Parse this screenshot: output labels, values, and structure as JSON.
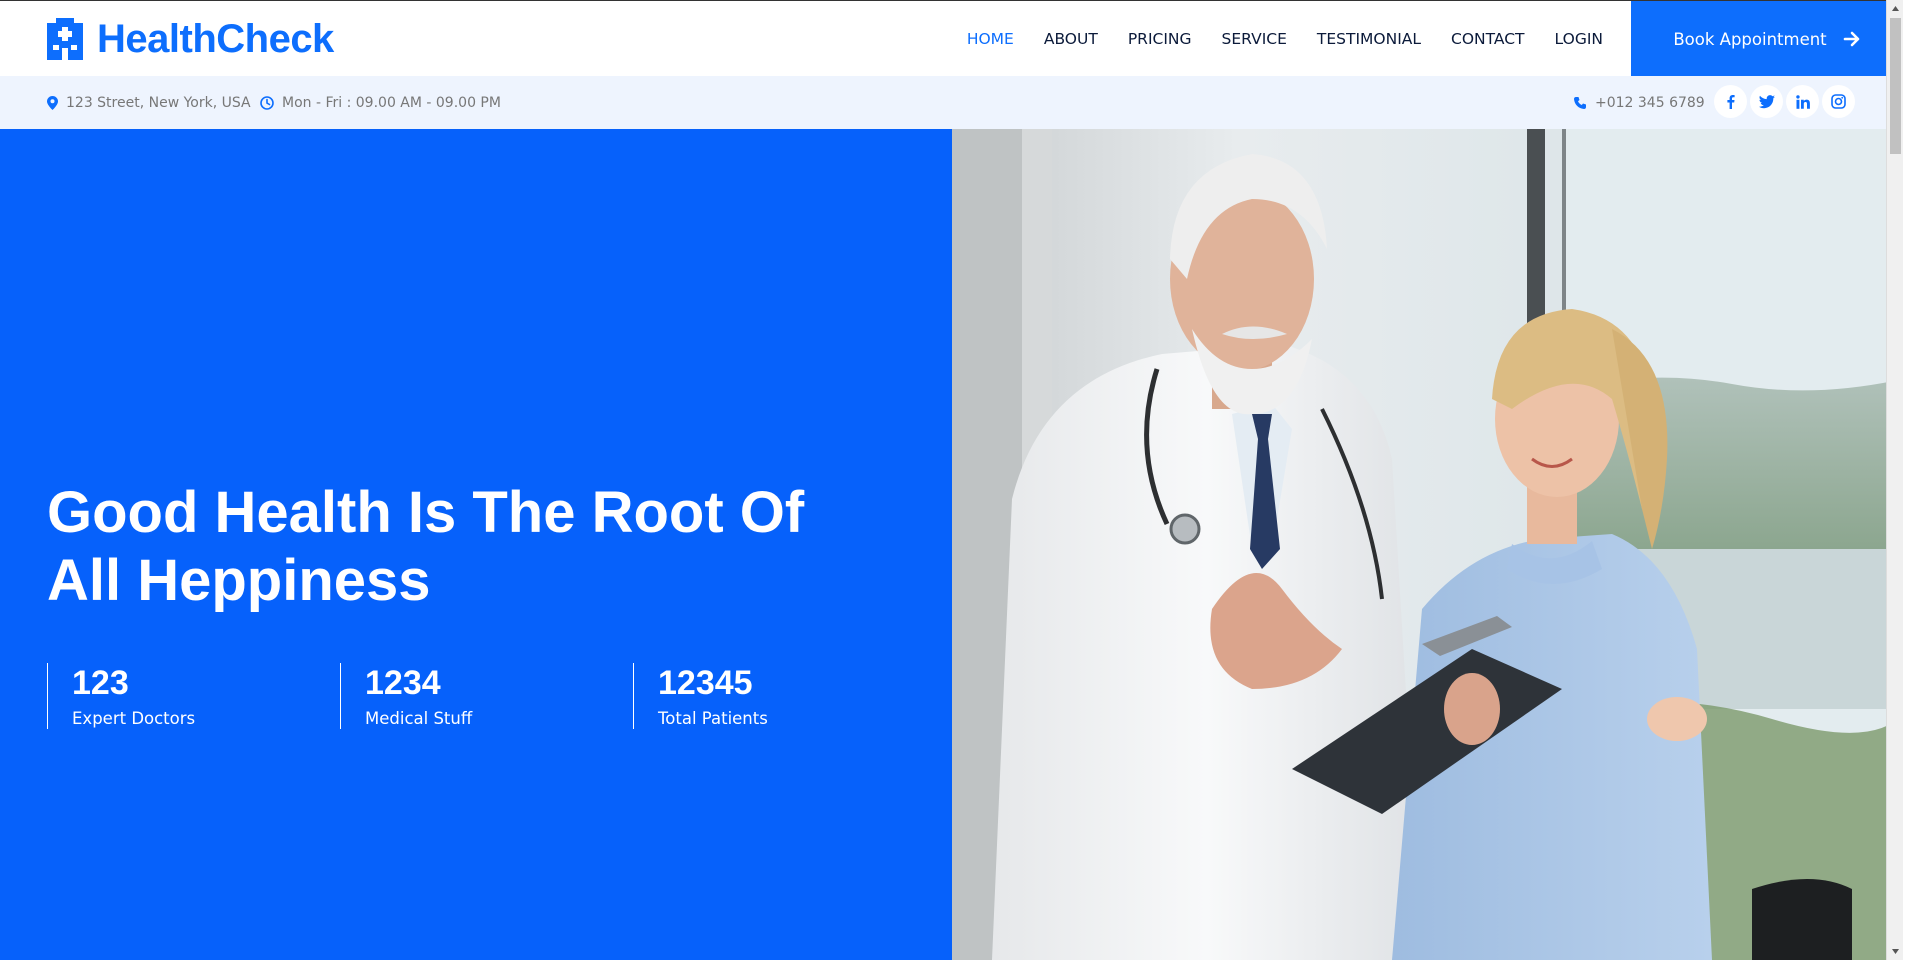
{
  "brand": {
    "name": "HealthCheck",
    "icon": "hospital-icon"
  },
  "nav": {
    "items": [
      {
        "label": "HOME",
        "active": true
      },
      {
        "label": "ABOUT",
        "active": false
      },
      {
        "label": "PRICING",
        "active": false
      },
      {
        "label": "SERVICE",
        "active": false
      },
      {
        "label": "TESTIMONIAL",
        "active": false
      },
      {
        "label": "CONTACT",
        "active": false
      },
      {
        "label": "LOGIN",
        "active": false
      }
    ],
    "cta_label": "Book Appointment",
    "cta_icon": "arrow-right-icon"
  },
  "topbar": {
    "address": "123 Street, New York, USA",
    "hours": "Mon - Fri : 09.00 AM - 09.00 PM",
    "phone": "+012 345 6789",
    "social": [
      "facebook-icon",
      "twitter-icon",
      "linkedin-icon",
      "instagram-icon"
    ]
  },
  "hero": {
    "title": "Good Health Is The Root Of All Heppiness",
    "stats": [
      {
        "value": "123",
        "label": "Expert Doctors"
      },
      {
        "value": "1234",
        "label": "Medical Stuff"
      },
      {
        "value": "12345",
        "label": "Total Patients"
      }
    ]
  },
  "colors": {
    "primary": "#0d6efd",
    "hero_bg": "#0661fb",
    "topbar_bg": "#eef4fe",
    "nav_text": "#0b1a3a",
    "muted": "#777777"
  }
}
